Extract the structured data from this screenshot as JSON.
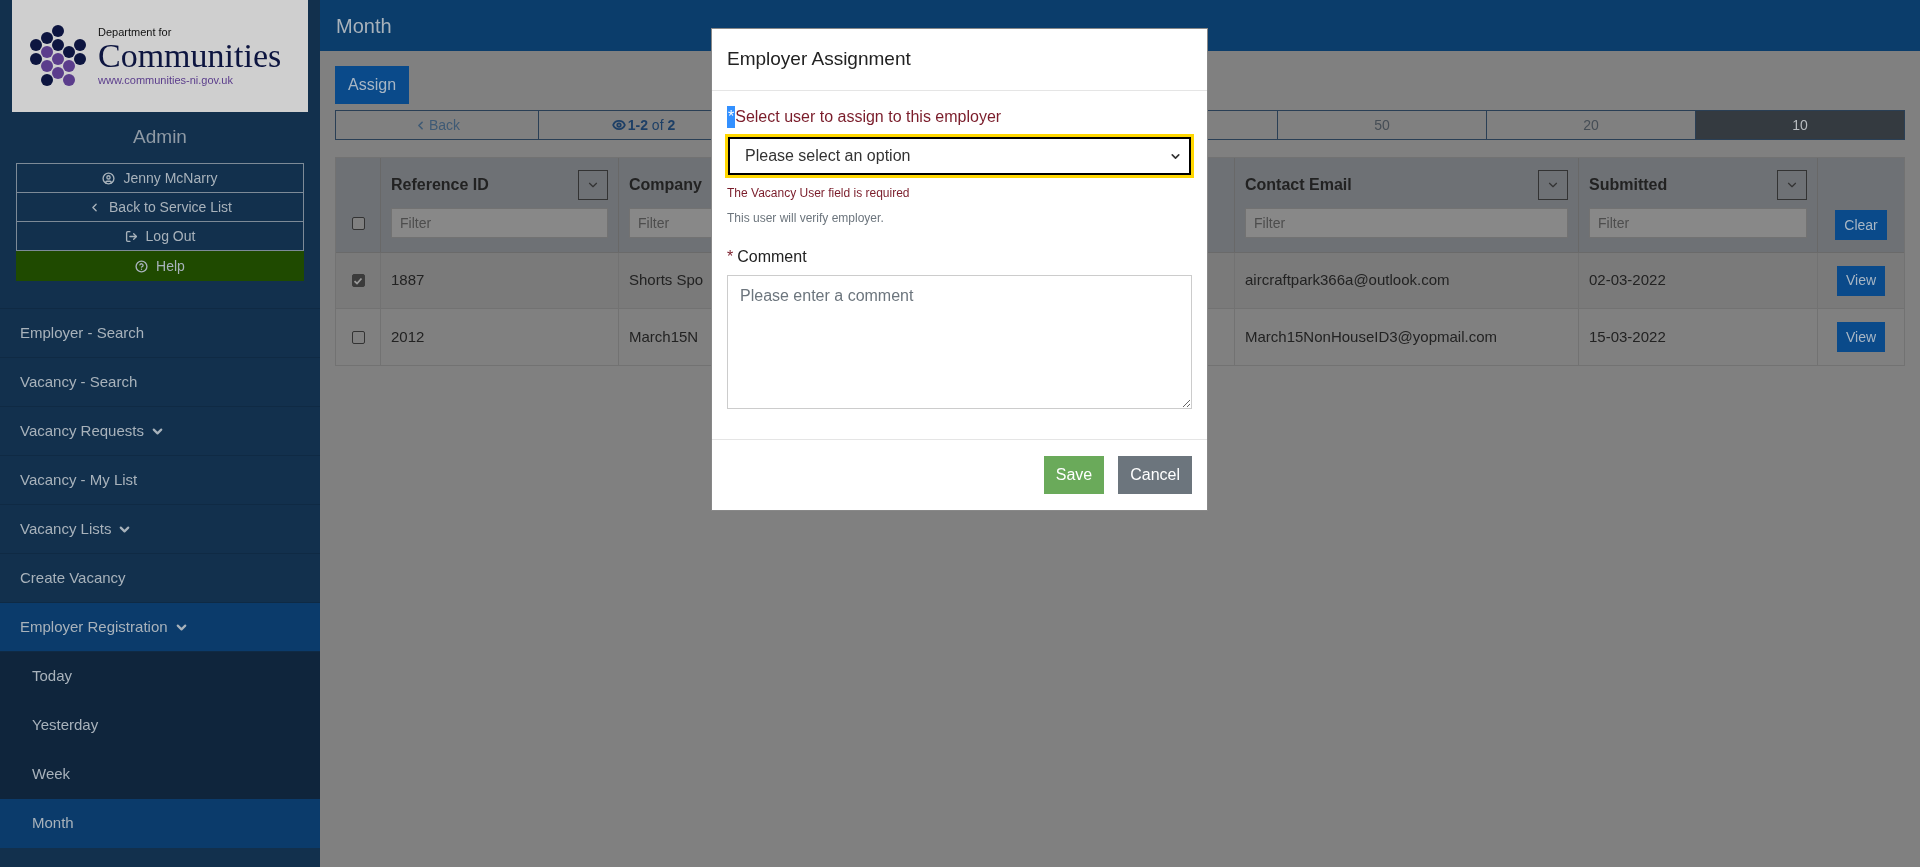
{
  "page_title": "Month",
  "sidebar": {
    "logo": {
      "line1": "Department for",
      "line2": "Communities",
      "url": "www.communities-ni.gov.uk"
    },
    "role": "Admin",
    "user_buttons": [
      {
        "kind": "user",
        "label": "Jenny McNarry"
      },
      {
        "kind": "back",
        "label": "Back to Service List"
      },
      {
        "kind": "logout",
        "label": "Log Out"
      },
      {
        "kind": "help",
        "label": "Help"
      }
    ],
    "nav": [
      {
        "label": "Employer - Search",
        "kind": "link",
        "selected": false
      },
      {
        "label": "Vacancy - Search",
        "kind": "link",
        "selected": false
      },
      {
        "label": "Vacancy Requests",
        "kind": "dropdown",
        "selected": false
      },
      {
        "label": "Vacancy - My List",
        "kind": "link",
        "selected": false
      },
      {
        "label": "Vacancy Lists",
        "kind": "dropdown",
        "selected": false
      },
      {
        "label": "Create Vacancy",
        "kind": "link",
        "selected": false
      },
      {
        "label": "Employer Registration",
        "kind": "dropdown",
        "selected": true,
        "children": [
          {
            "label": "Today",
            "selected": false
          },
          {
            "label": "Yesterday",
            "selected": false
          },
          {
            "label": "Week",
            "selected": false
          },
          {
            "label": "Month",
            "selected": true
          }
        ]
      }
    ]
  },
  "toolbar": {
    "assign_button": "Assign"
  },
  "pager": {
    "back": "Back",
    "info": "**1-2** of **2**",
    "page_sizes": [
      {
        "label": "50",
        "selected": false
      },
      {
        "label": "20",
        "selected": false
      },
      {
        "label": "10",
        "selected": true
      }
    ]
  },
  "table": {
    "select_all_checked": false,
    "columns": [
      {
        "title": "Reference ID",
        "filter_placeholder": "Filter"
      },
      {
        "title": "Company",
        "filter_placeholder": "Filter"
      },
      {
        "title": "Contact Email",
        "filter_placeholder": "Filter"
      },
      {
        "title": "Submitted",
        "filter_placeholder": "Filter"
      }
    ],
    "clear_button": "Clear",
    "rows": [
      {
        "checked": true,
        "cells": [
          "1887",
          "Shorts Spo",
          "aircraftpark366a@outlook.com",
          "02-03-2022"
        ],
        "action": "View"
      },
      {
        "checked": false,
        "cells": [
          "2012",
          "March15N",
          "March15NonHouseID3@yopmail.com",
          "15-03-2022"
        ],
        "action": "View"
      }
    ]
  },
  "modal": {
    "title": "Employer Assignment",
    "select_label_mark": "*",
    "select_label": "Select user to assign to this employer",
    "select_placeholder": "Please select an option",
    "error": "The Vacancy User field is required",
    "help": "This user will verify employer.",
    "comment_label_mark": "*",
    "comment_label": "Comment",
    "comment_placeholder": "Please enter a comment",
    "buttons": [
      {
        "kind": "save",
        "label": "Save"
      },
      {
        "kind": "cancel",
        "label": "Cancel"
      }
    ]
  }
}
